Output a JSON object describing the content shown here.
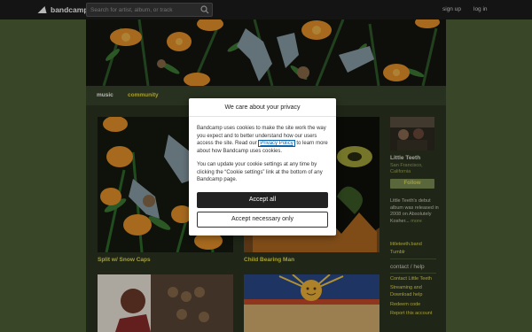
{
  "header": {
    "logo_text": "bandcamp",
    "search_placeholder": "Search for artist, album, or track",
    "signup_label": "sign up",
    "login_label": "log in"
  },
  "tabs": [
    {
      "label": "music",
      "active": true
    },
    {
      "label": "community",
      "active": false
    }
  ],
  "albums": [
    {
      "title": "Split w/ Snow Caps"
    },
    {
      "title": "Child Bearing Man"
    }
  ],
  "artist": {
    "name": "Little Teeth",
    "location": "San Francisco, California",
    "follow_label": "Follow",
    "bio": "Little Teeth's debut album was released in 2008 on Absolutely Kosher...",
    "bio_more": "more",
    "links": [
      "littleteeth.band",
      "Tumblr"
    ],
    "contact_heading": "contact / help",
    "help_links": [
      "Contact Little Teeth",
      "Streaming and Download help",
      "Redeem code",
      "Report this account"
    ]
  },
  "cookie_dialog": {
    "title": "We care about your privacy",
    "text_before_link": "Bandcamp uses cookies to make the site work the way you expect and to better understand how our users access the site. Read our ",
    "link_text": "Privacy Policy",
    "text_after_link": " to learn more about how Bandcamp uses cookies.",
    "settings_text": "You can update your cookie settings at any time by clicking the “Cookie settings” link at the bottom of any Bandcamp page.",
    "accept_all_label": "Accept all",
    "accept_necessary_label": "Accept necessary only"
  },
  "colors": {
    "background": "#4f6138",
    "link_accent": "#e4dc51",
    "top_bar": "#1c1c1c"
  }
}
